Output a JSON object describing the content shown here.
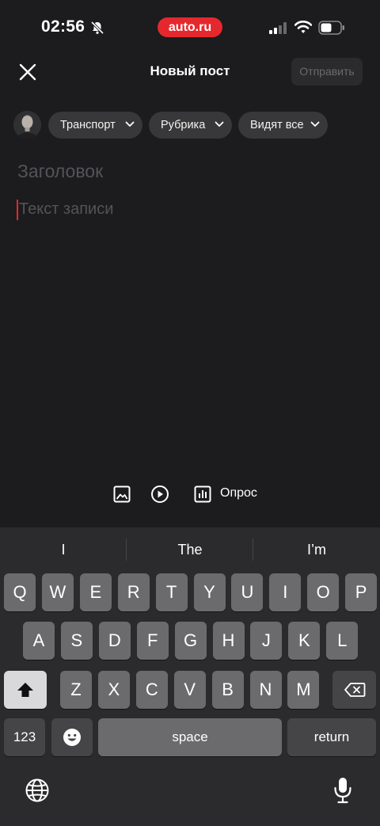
{
  "status": {
    "time": "02:56",
    "app_badge": "auto.ru"
  },
  "header": {
    "title": "Новый пост",
    "send_label": "Отправить"
  },
  "chips": {
    "category": "Транспорт",
    "rubric": "Рубрика",
    "visibility": "Видят все"
  },
  "editor": {
    "headline_placeholder": "Заголовок",
    "body_placeholder": "Текст записи"
  },
  "toolbar": {
    "poll_label": "Опрос"
  },
  "keyboard": {
    "suggestions": [
      "I",
      "The",
      "I’m"
    ],
    "row1": [
      "Q",
      "W",
      "E",
      "R",
      "T",
      "Y",
      "U",
      "I",
      "O",
      "P"
    ],
    "row2": [
      "A",
      "S",
      "D",
      "F",
      "G",
      "H",
      "J",
      "K",
      "L"
    ],
    "row3": [
      "Z",
      "X",
      "C",
      "V",
      "B",
      "N",
      "M"
    ],
    "numbers_label": "123",
    "space_label": "space",
    "return_label": "return"
  },
  "colors": {
    "accent": "#e5282d",
    "background": "#1c1b1d",
    "chip": "#38373a"
  }
}
